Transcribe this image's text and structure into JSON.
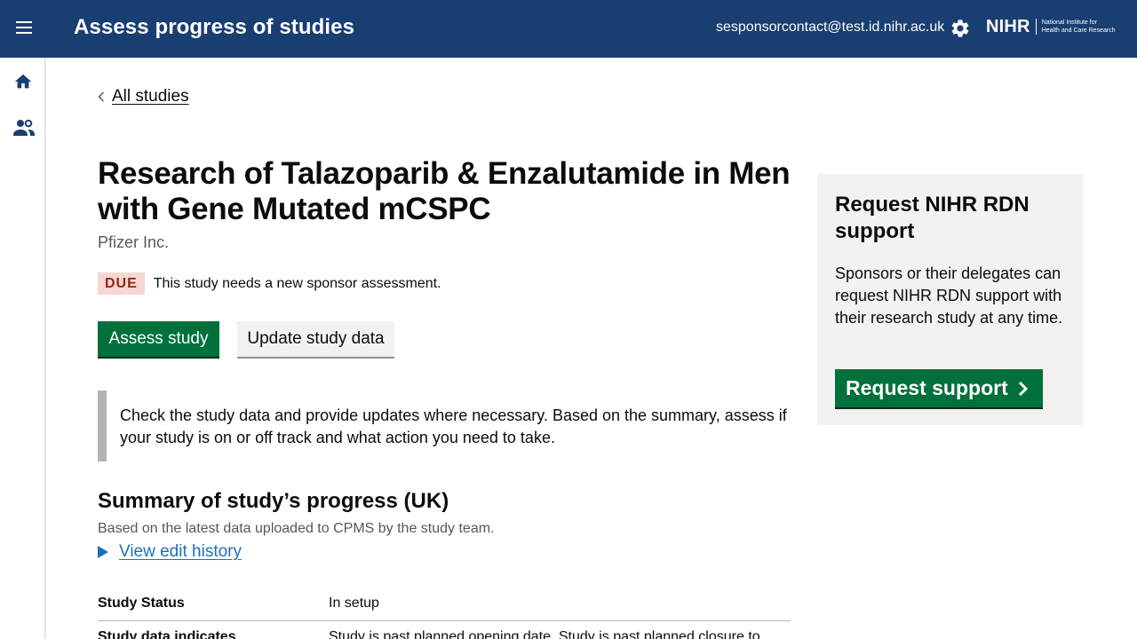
{
  "header": {
    "title": "Assess progress of studies",
    "user_email": "sesponsorcontact@test.id.nihr.ac.uk",
    "logo_word": "NIHR",
    "logo_sub_line1": "National Institute for",
    "logo_sub_line2": "Health and Care Research",
    "background": "#193e72"
  },
  "sidenav": {
    "items": [
      {
        "icon": "home-icon"
      },
      {
        "icon": "users-icon"
      }
    ]
  },
  "back_link": "All studies",
  "study": {
    "title": "Research of Talazoparib & Enzalutamide in Men with Gene Mutated mCSPC",
    "sponsor": "Pfizer Inc.",
    "status_badge": "DUE",
    "status_message": "This study needs a new sponsor assessment."
  },
  "actions": {
    "assess": "Assess study",
    "update": "Update study data"
  },
  "inset_text": "Check the study data and provide updates where necessary. Based on the summary, assess if your study is on or off track and what action you need to take.",
  "summary": {
    "title": "Summary of study’s progress (UK)",
    "subtitle": "Based on the latest data uploaded to CPMS by the study team.",
    "history_link": "View edit history",
    "rows": [
      {
        "key": "Study Status",
        "value": "In setup"
      },
      {
        "key": "Study data indicates",
        "value": "Study is past planned opening date. Study is past planned closure to"
      }
    ]
  },
  "support_panel": {
    "title": "Request NIHR RDN support",
    "body": "Sponsors or their delegates can request NIHR RDN support with their research study at any time.",
    "button": "Request support"
  },
  "colors": {
    "primary_green": "#00703c",
    "link_blue": "#1d70b8",
    "due_bg": "#f6d7d2",
    "due_text": "#942514",
    "panel_bg": "#f3f2f1"
  }
}
